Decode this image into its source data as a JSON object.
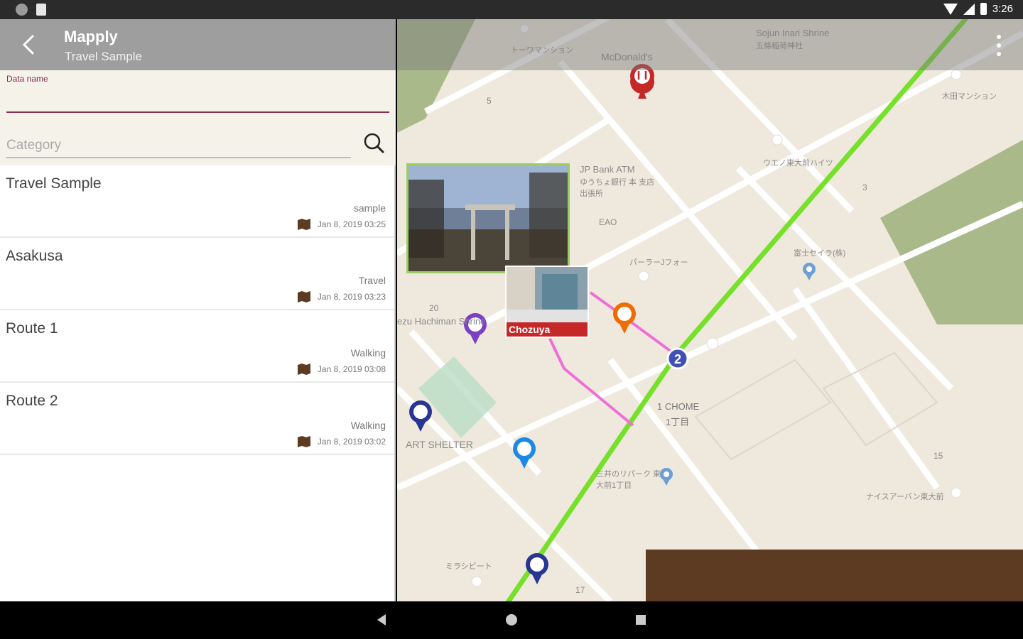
{
  "status_bar": {
    "time": "3:26"
  },
  "toolbar": {
    "title": "Mapply",
    "subtitle": "Travel Sample"
  },
  "form": {
    "data_name_label": "Data name",
    "data_name_value": "",
    "category_placeholder": "Category"
  },
  "list": [
    {
      "title": "Travel Sample",
      "category": "sample",
      "date": "Jan 8, 2019 03:25"
    },
    {
      "title": "Asakusa",
      "category": "Travel",
      "date": "Jan 8, 2019 03:23"
    },
    {
      "title": "Route 1",
      "category": "Walking",
      "date": "Jan 8, 2019 03:08"
    },
    {
      "title": "Route 2",
      "category": "Walking",
      "date": "Jan 8, 2019 03:02"
    }
  ],
  "map": {
    "labels": {
      "mcdonalds": "McDonald's",
      "shrine": "Sojun Inari Shrine",
      "shrine_jp": "五條稲荷神社",
      "mansion": "トーワマンション",
      "bank": "JP Bank ATM",
      "bank_jp": "ゆうちょ銀行 本 支店 出張所",
      "hachiman": "ezu Hachiman Shrine",
      "art_shelter": "ART SHELTER",
      "chome": "1 CHOME",
      "chome_jp": "1丁目",
      "store1": "富士セイラ(株)",
      "store2": "ウエノ東大前ハイツ",
      "store3": "パーラーJフォー",
      "store4": "ナイスアーバン東大前",
      "store5": "三井のリパーク 東大前1丁目",
      "store6": "ミラシビート",
      "mansion2": "木田マンション",
      "n5": "5",
      "n3": "3",
      "n20": "20",
      "n15": "15",
      "n17": "17",
      "eao": "EAO",
      "chozuya": "Chozuya",
      "route_marker": "2"
    },
    "colors": {
      "route_main": "#76e02a",
      "route_pink": "#ef6fd8",
      "marker_red": "#c62828",
      "marker_purple": "#7b3fc2",
      "marker_blue": "#283593",
      "marker_orange": "#ef6c00"
    }
  }
}
